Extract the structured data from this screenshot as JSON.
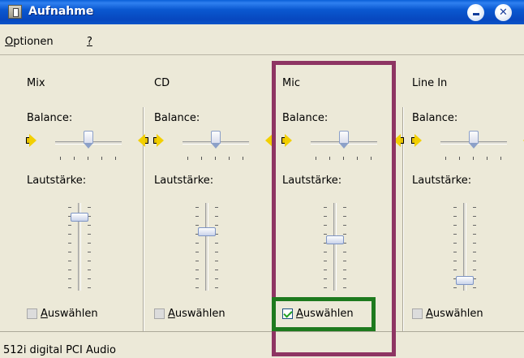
{
  "window": {
    "title": "Aufnahme"
  },
  "menu": {
    "options": "Optionen",
    "options_mnemonic": "O",
    "options_rest": "ptionen",
    "help": "?"
  },
  "channels": [
    {
      "name": "Mix",
      "balance_label": "Balance:",
      "volume_label": "Lautstärke:",
      "select_label": "Auswählen",
      "select_mnemonic": "A",
      "select_rest": "uswählen",
      "selected": false,
      "volume_level": 0.88,
      "balance_level": 0.5
    },
    {
      "name": "CD",
      "balance_label": "Balance:",
      "volume_label": "Lautstärke:",
      "select_label": "Auswählen",
      "select_mnemonic": "A",
      "select_rest": "uswählen",
      "selected": false,
      "volume_level": 0.7,
      "balance_level": 0.5
    },
    {
      "name": "Mic",
      "balance_label": "Balance:",
      "volume_label": "Lautstärke:",
      "select_label": "Auswählen",
      "select_mnemonic": "A",
      "select_rest": "uswählen",
      "selected": true,
      "volume_level": 0.6,
      "balance_level": 0.5
    },
    {
      "name": "Line In",
      "balance_label": "Balance:",
      "volume_label": "Lautstärke:",
      "select_label": "Auswählen",
      "select_mnemonic": "A",
      "select_rest": "uswählen",
      "selected": false,
      "volume_level": 0.1,
      "balance_level": 0.5
    }
  ],
  "status": {
    "text": "512i digital PCI Audio"
  },
  "colors": {
    "highlight_channel": "#8e3563",
    "highlight_checkbox": "#1e7a1e",
    "titlebar": "#0a58d0"
  },
  "icons": {
    "app": "mixer-app-icon",
    "minimize": "minimize-icon",
    "close": "close-icon",
    "speaker": "speaker-icon"
  }
}
